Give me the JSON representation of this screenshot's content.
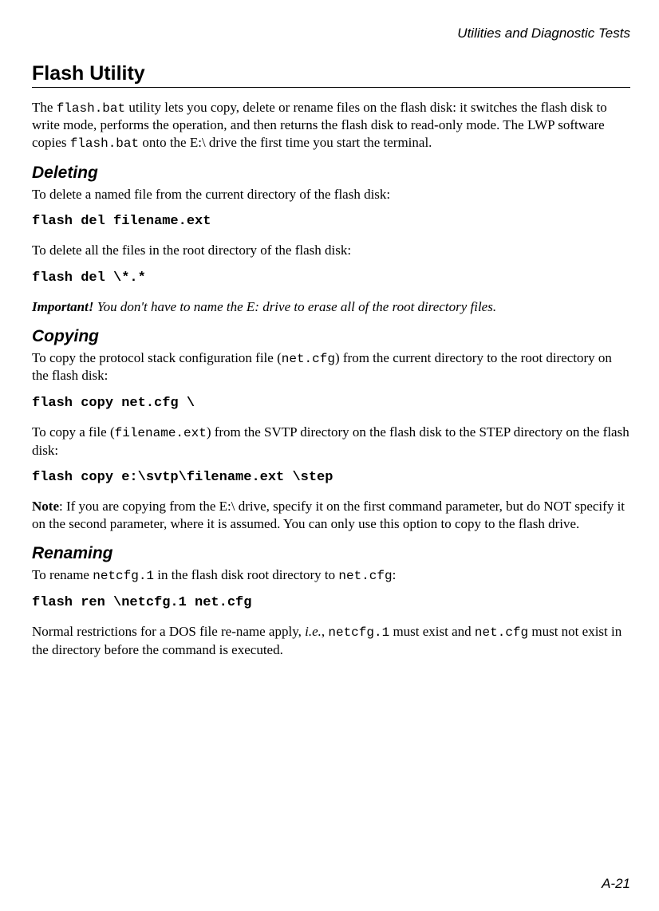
{
  "header": {
    "running": "Utilities and Diagnostic Tests"
  },
  "h1": "Flash Utility",
  "intro": {
    "pre1": "The ",
    "code1": "flash.bat",
    "mid1": " utility lets you copy, delete or rename files on the flash disk: it switches the flash disk to write mode, performs the operation, and then returns the flash disk to read-only mode. The LWP software copies ",
    "code2": "flash.bat",
    "post1": " onto the E:\\ drive the first time you start the terminal."
  },
  "deleting": {
    "heading": "Deleting",
    "p1": "To delete a named file from the current directory of the flash disk:",
    "cmd1": "flash del filename.ext",
    "p2": "To delete all the files in the root directory of the flash disk:",
    "cmd2": "flash del \\*.*",
    "important_label": "Important!",
    "important_text": " You don't have to name the E: drive to erase all of the root directory files."
  },
  "copying": {
    "heading": "Copying",
    "p1_pre": "To copy the protocol stack configuration file (",
    "p1_code": "net.cfg",
    "p1_post": ") from the current directory to the root directory on the flash disk:",
    "cmd1": "flash copy net.cfg \\",
    "p2_pre": "To copy a file (",
    "p2_code": "filename.ext",
    "p2_post": ") from the SVTP directory on the flash disk to the STEP directory on the flash disk:",
    "cmd2": "flash copy e:\\svtp\\filename.ext \\step",
    "note_label": "Note",
    "note_text": ": If you are copying from the E:\\ drive, specify it on the first command parameter, but do NOT specify it on the second parameter, where it is assumed. You can only use this option to copy to the flash drive."
  },
  "renaming": {
    "heading": "Renaming",
    "p1_pre": "To rename ",
    "p1_code1": "netcfg.1",
    "p1_mid": " in the flash disk root directory to ",
    "p1_code2": "net.cfg",
    "p1_post": ":",
    "cmd1": "flash ren \\netcfg.1 net.cfg",
    "p2_pre": "Normal restrictions for a DOS file re-name apply, ",
    "p2_ie": "i.e.",
    "p2_mid1": ", ",
    "p2_code1": "netcfg.1",
    "p2_mid2": " must exist and ",
    "p2_code2": "net.cfg",
    "p2_post": " must not exist in the directory before the command is executed."
  },
  "page_number": "A-21"
}
